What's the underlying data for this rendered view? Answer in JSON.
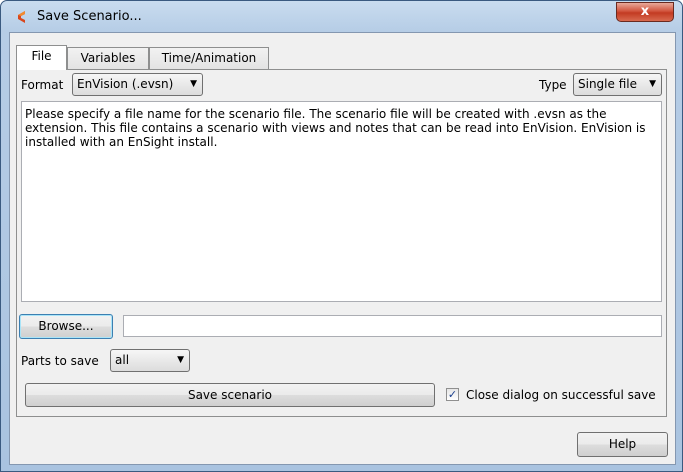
{
  "window": {
    "title": "Save Scenario...",
    "close_glyph": "x",
    "app_icon": "ensight-logo-icon"
  },
  "tabs": [
    {
      "label": "File",
      "active": true
    },
    {
      "label": "Variables",
      "active": false
    },
    {
      "label": "Time/Animation",
      "active": false
    }
  ],
  "format": {
    "label": "Format",
    "value": "EnVision (.evsn)"
  },
  "type": {
    "label": "Type",
    "value": "Single file"
  },
  "description": "Please specify a file name for the scenario file.  The scenario file will be created with .evsn as the extension.  This file contains a scenario with views and notes that can be read into EnVision.  EnVision is installed with an EnSight install.",
  "browse": {
    "label": "Browse...",
    "path_value": ""
  },
  "parts": {
    "label": "Parts to save",
    "value": "all"
  },
  "save_button": "Save scenario",
  "close_on_save": {
    "label": "Close dialog on successful save",
    "checked": true
  },
  "help_button": "Help",
  "colors": {
    "accent": "#3c7fb1",
    "close_red": "#c33a22"
  }
}
